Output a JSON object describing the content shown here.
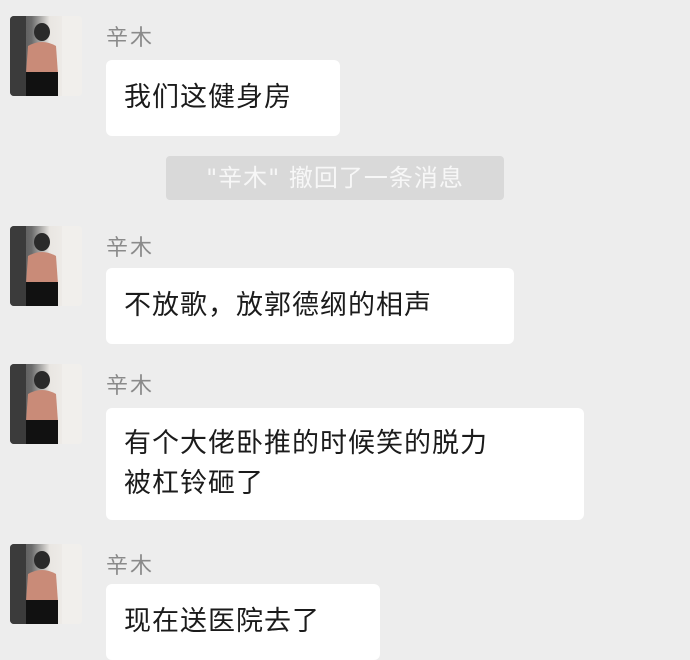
{
  "messages": [
    {
      "sender": "辛木",
      "text": "我们这健身房"
    },
    {
      "sender": "辛木",
      "text": "不放歌，放郭德纲的相声"
    },
    {
      "sender": "辛木",
      "line1": "有个大佬卧推的时候笑的脱力",
      "line2": "被杠铃砸了"
    },
    {
      "sender": "辛木",
      "text": "现在送医院去了"
    }
  ],
  "system_notice": "\"辛木\" 撤回了一条消息",
  "avatar_icon": "user-avatar-icon",
  "colors": {
    "background": "#ededed",
    "bubble": "#ffffff",
    "sender": "#8a8a8a",
    "system_pill": "#d9d9d9"
  }
}
